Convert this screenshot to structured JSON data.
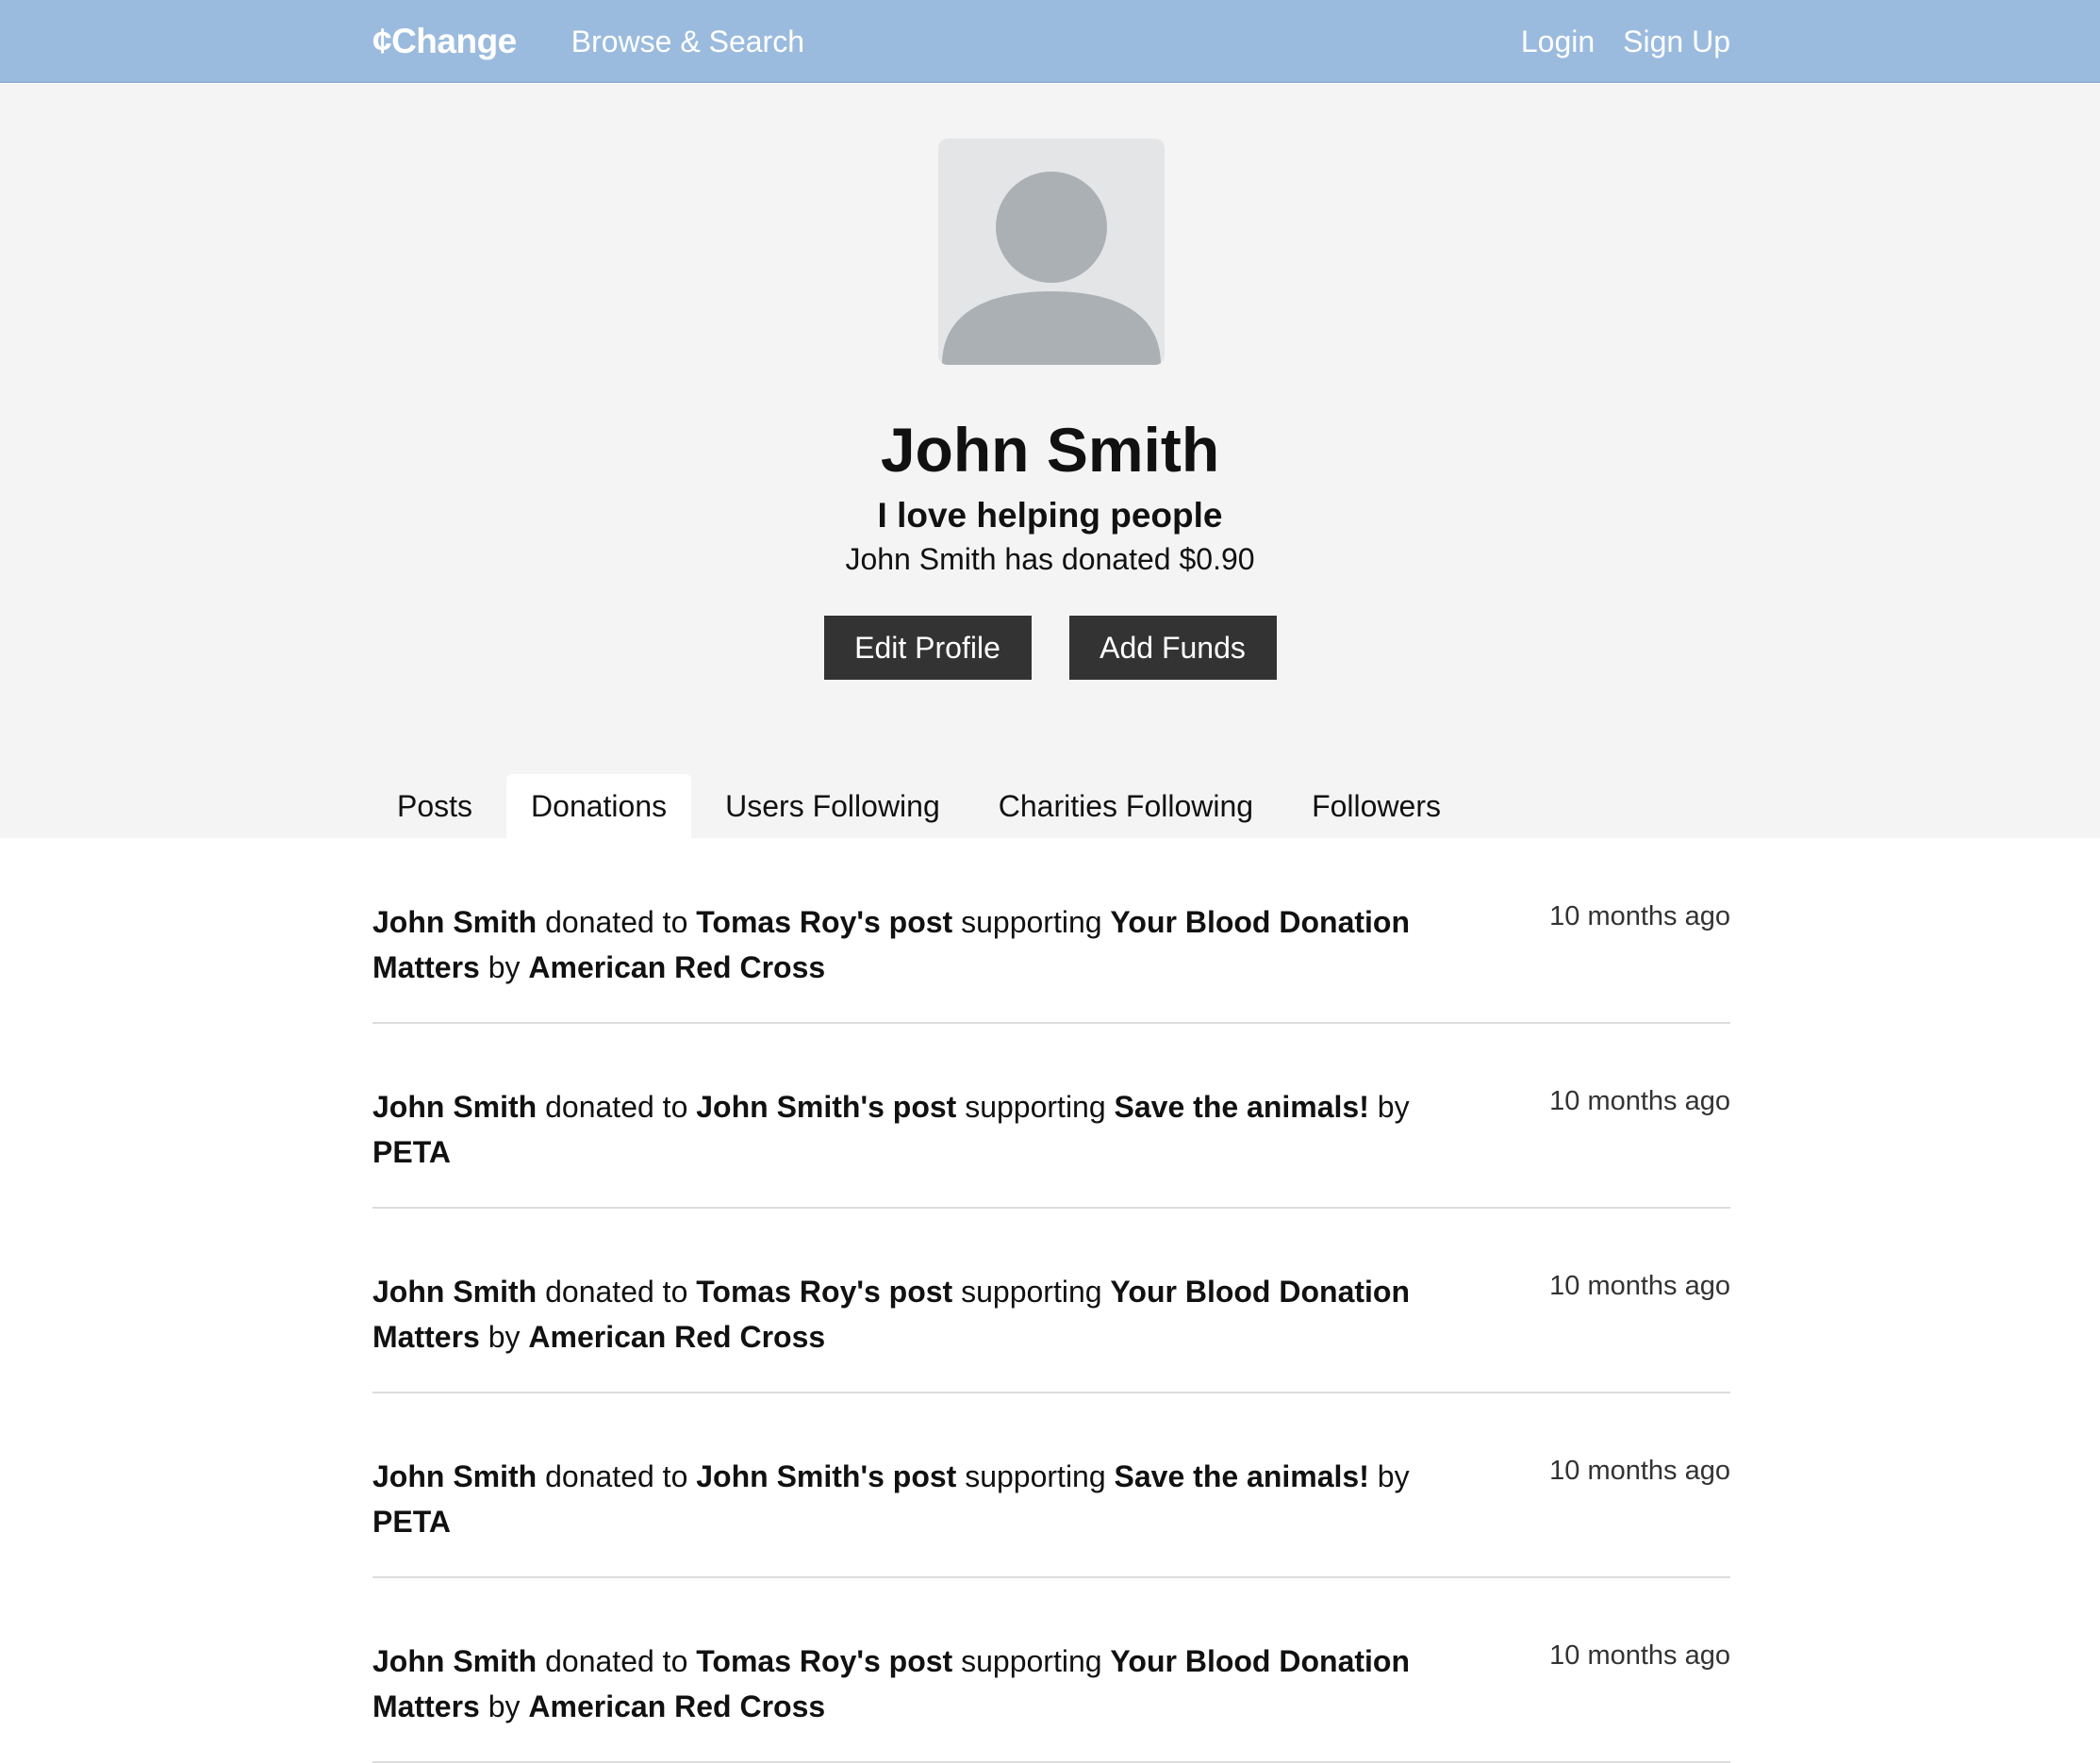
{
  "nav": {
    "brand": "¢Change",
    "browse": "Browse & Search",
    "login": "Login",
    "signup": "Sign Up"
  },
  "profile": {
    "name": "John Smith",
    "bio": "I love helping people",
    "donated_text": "John Smith has donated $0.90",
    "edit_label": "Edit Profile",
    "funds_label": "Add Funds"
  },
  "tabs": [
    {
      "label": "Posts",
      "active": false
    },
    {
      "label": "Donations",
      "active": true
    },
    {
      "label": "Users Following",
      "active": false
    },
    {
      "label": "Charities Following",
      "active": false
    },
    {
      "label": "Followers",
      "active": false
    }
  ],
  "feed": [
    {
      "user": "John Smith",
      "w1": "donated to",
      "post": "Tomas Roy's post",
      "w2": "supporting",
      "campaign": "Your Blood Donation Matters",
      "w3": "by",
      "charity": "American Red Cross",
      "time": "10 months ago"
    },
    {
      "user": "John Smith",
      "w1": "donated to",
      "post": "John Smith's post",
      "w2": "supporting",
      "campaign": "Save the animals!",
      "w3": "by",
      "charity": "PETA",
      "time": "10 months ago"
    },
    {
      "user": "John Smith",
      "w1": "donated to",
      "post": "Tomas Roy's post",
      "w2": "supporting",
      "campaign": "Your Blood Donation Matters",
      "w3": "by",
      "charity": "American Red Cross",
      "time": "10 months ago"
    },
    {
      "user": "John Smith",
      "w1": "donated to",
      "post": "John Smith's post",
      "w2": "supporting",
      "campaign": "Save the animals!",
      "w3": "by",
      "charity": "PETA",
      "time": "10 months ago"
    },
    {
      "user": "John Smith",
      "w1": "donated to",
      "post": "Tomas Roy's post",
      "w2": "supporting",
      "campaign": "Your Blood Donation Matters",
      "w3": "by",
      "charity": "American Red Cross",
      "time": "10 months ago"
    }
  ],
  "colors": {
    "navbar": "#9bbbde",
    "hero_bg": "#f4f4f4",
    "button_bg": "#333333",
    "avatar_bg": "#e4e5e7",
    "avatar_fg": "#abb0b5"
  },
  "icons": {
    "avatar": "default-user-icon"
  }
}
